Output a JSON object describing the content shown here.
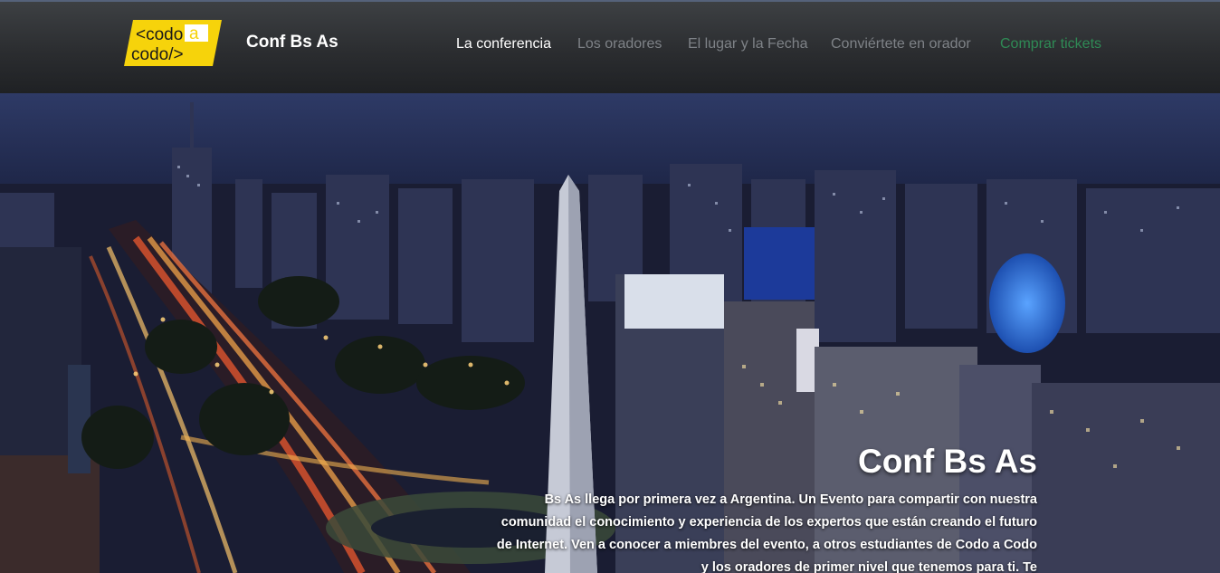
{
  "header": {
    "logo": {
      "line1": "<codo",
      "accent": "a",
      "line2": "codo/>",
      "bg_color": "#f6d30b"
    },
    "brand": "Conf Bs As",
    "nav": [
      {
        "label": "La conferencia",
        "state": "active"
      },
      {
        "label": "Los oradores",
        "state": "normal"
      },
      {
        "label": "El lugar y la Fecha",
        "state": "normal"
      },
      {
        "label": "Conviértete en orador",
        "state": "normal"
      },
      {
        "label": "Comprar tickets",
        "state": "highlight",
        "color": "#2f8a55"
      }
    ]
  },
  "hero": {
    "title": "Conf Bs As",
    "description": "Bs As llega por primera vez a Argentina. Un Evento para compartir con nuestra comunidad el conocimiento y experiencia de los expertos que están creando el futuro de Internet. Ven a conocer a miembres del evento, a otros estudiantes de Codo a Codo y los oradores de primer nivel que tenemos para ti. Te"
  }
}
